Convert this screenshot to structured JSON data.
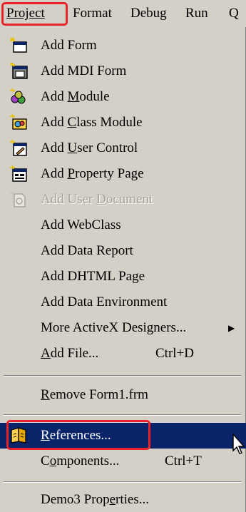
{
  "menubar": {
    "project": "Project",
    "format": "Format",
    "debug": "Debug",
    "run": "Run",
    "q": "Q"
  },
  "items": [
    {
      "label": "Add Form",
      "icon": "add-form-icon"
    },
    {
      "label": "Add MDI Form",
      "icon": "add-mdi-form-icon"
    },
    {
      "label": "Add Module",
      "icon": "add-module-icon"
    },
    {
      "label": "Add Class Module",
      "icon": "add-class-module-icon"
    },
    {
      "label": "Add User Control",
      "icon": "add-user-control-icon"
    },
    {
      "label": "Add Property Page",
      "icon": "add-property-page-icon"
    },
    {
      "label": "Add User Document",
      "icon": "add-user-document-icon",
      "disabled": true
    },
    {
      "label": "Add WebClass"
    },
    {
      "label": "Add Data Report"
    },
    {
      "label": "Add DHTML Page"
    },
    {
      "label": "Add Data Environment"
    },
    {
      "label": "More ActiveX Designers...",
      "submenu_arrow": "▶"
    },
    {
      "label": "Add File...",
      "shortcut": "Ctrl+D"
    },
    {
      "label": "Remove Form1.frm"
    },
    {
      "label": "References...",
      "icon": "references-icon",
      "selected": true
    },
    {
      "label": "Components...",
      "shortcut": "Ctrl+T"
    },
    {
      "label": "Demo3 Properties..."
    }
  ],
  "colors": {
    "menu_bg": "#d4d0c8",
    "highlight": "#0a246a",
    "highlight_text": "#ffffff",
    "annotation_red": "#e8222a",
    "disabled_text": "#a7a49d"
  }
}
